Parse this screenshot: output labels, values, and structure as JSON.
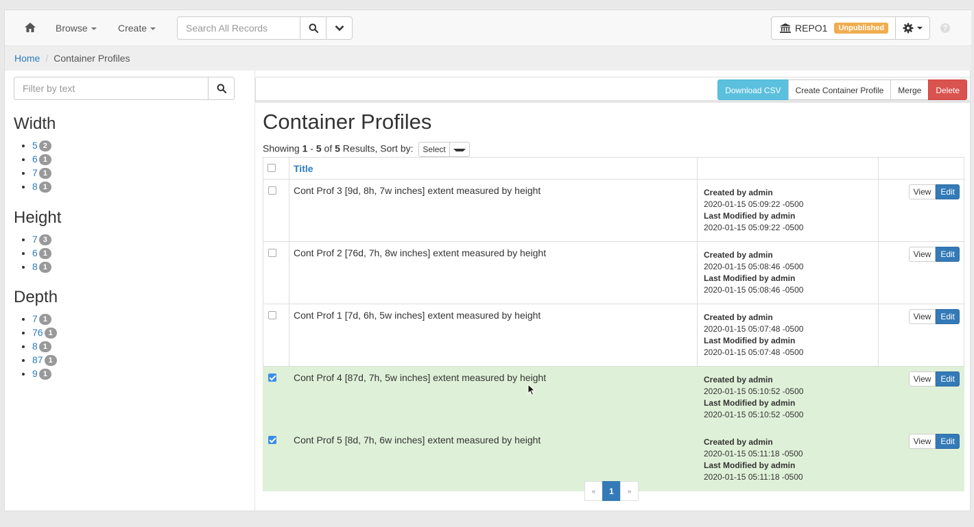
{
  "navbar": {
    "browse_label": "Browse",
    "create_label": "Create",
    "search_placeholder": "Search All Records",
    "repo_name": "REPO1",
    "repo_status": "Unpublished",
    "help_glyph": "?"
  },
  "breadcrumb": {
    "home": "Home",
    "separator": "/",
    "current": "Container Profiles"
  },
  "sidebar": {
    "filter_placeholder": "Filter by text",
    "facets": [
      {
        "title": "Width",
        "items": [
          {
            "label": "5",
            "count": "2"
          },
          {
            "label": "6",
            "count": "1"
          },
          {
            "label": "7",
            "count": "1"
          },
          {
            "label": "8",
            "count": "1"
          }
        ]
      },
      {
        "title": "Height",
        "items": [
          {
            "label": "7",
            "count": "3"
          },
          {
            "label": "6",
            "count": "1"
          },
          {
            "label": "8",
            "count": "1"
          }
        ]
      },
      {
        "title": "Depth",
        "items": [
          {
            "label": "7",
            "count": "1"
          },
          {
            "label": "76",
            "count": "1"
          },
          {
            "label": "8",
            "count": "1"
          },
          {
            "label": "87",
            "count": "1"
          },
          {
            "label": "9",
            "count": "1"
          }
        ]
      }
    ]
  },
  "toolbar": {
    "download_csv": "Download CSV",
    "create_profile": "Create Container Profile",
    "merge": "Merge",
    "delete": "Delete"
  },
  "main": {
    "title": "Container Profiles",
    "showing_prefix": "Showing",
    "range_start": "1",
    "range_dash": "-",
    "range_end": "5",
    "of_label": "of",
    "total": "5",
    "results_sort_label": "Results, Sort by:",
    "sort_value": "Select",
    "col_title": "Title"
  },
  "rows": [
    {
      "title": "Cont Prof 3 [9d, 8h, 7w inches] extent measured by height",
      "created_by": "Created by admin",
      "created_at": "2020-01-15 05:09:22 -0500",
      "modified_by": "Last Modified by admin",
      "modified_at": "2020-01-15 05:09:22 -0500",
      "checked": false
    },
    {
      "title": "Cont Prof 2 [76d, 7h, 8w inches] extent measured by height",
      "created_by": "Created by admin",
      "created_at": "2020-01-15 05:08:46 -0500",
      "modified_by": "Last Modified by admin",
      "modified_at": "2020-01-15 05:08:46 -0500",
      "checked": false
    },
    {
      "title": "Cont Prof 1 [7d, 6h, 5w inches] extent measured by height",
      "created_by": "Created by admin",
      "created_at": "2020-01-15 05:07:48 -0500",
      "modified_by": "Last Modified by admin",
      "modified_at": "2020-01-15 05:07:48 -0500",
      "checked": false
    },
    {
      "title": "Cont Prof 4 [87d, 7h, 5w inches] extent measured by height",
      "created_by": "Created by admin",
      "created_at": "2020-01-15 05:10:52 -0500",
      "modified_by": "Last Modified by admin",
      "modified_at": "2020-01-15 05:10:52 -0500",
      "checked": true
    },
    {
      "title": "Cont Prof 5 [8d, 7h, 6w inches] extent measured by height",
      "created_by": "Created by admin",
      "created_at": "2020-01-15 05:11:18 -0500",
      "modified_by": "Last Modified by admin",
      "modified_at": "2020-01-15 05:11:18 -0500",
      "checked": true
    }
  ],
  "row_actions": {
    "view": "View",
    "edit": "Edit"
  },
  "pager": {
    "prev": "«",
    "current": "1",
    "next": "»"
  },
  "colors": {
    "accent": "#337ab7",
    "info": "#5bc0de",
    "danger": "#d9534f",
    "warning": "#f0ad4e",
    "selected_row": "#dff0d8"
  },
  "icons": {
    "home": "home-icon",
    "search": "search-icon",
    "chevron": "chevron-down-icon",
    "bank": "institution-icon",
    "gear": "gear-icon",
    "help": "help-icon"
  }
}
